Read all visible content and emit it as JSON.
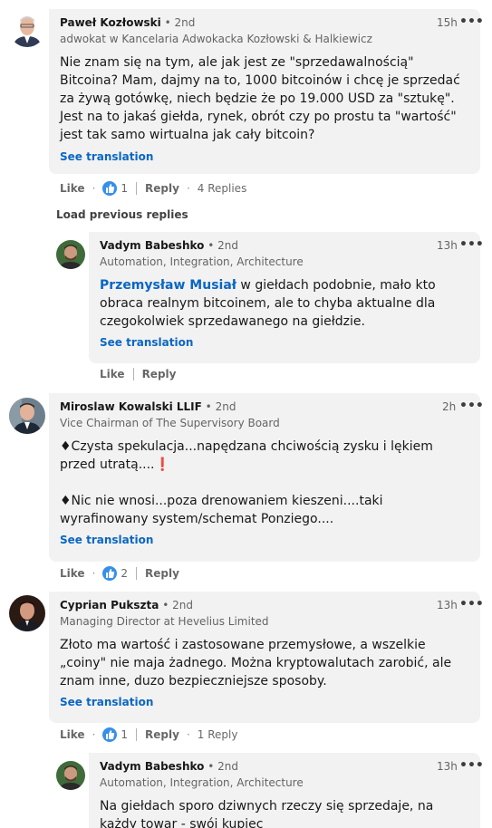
{
  "comments": [
    {
      "name": "Paweł Kozłowski",
      "degree": "2nd",
      "headline": "adwokat w Kancelaria Adwokacka Kozłowski & Halkiewicz",
      "time": "15h",
      "text": "Nie znam się na tym, ale jak jest ze \"sprzedawalnością\" Bitcoina? Mam, dajmy na to, 1000 bitcoinów i chcę je sprzedać za żywą gotówkę, niech będzie że po 19.000 USD za \"sztukę\". Jest na to jakaś giełda, rynek, obrót czy po prostu ta \"wartość\" jest tak samo wirtualna jak cały bitcoin?",
      "see_translation": "See translation",
      "like": "Like",
      "reactions": "1",
      "reply": "Reply",
      "replies_count": "4 Replies"
    },
    {
      "name": "Vadym Babeshko",
      "degree": "2nd",
      "headline": "Automation, Integration, Architecture",
      "time": "13h",
      "mention": "Przemysław Musiał",
      "text": " w giełdach podobnie, mało kto obraca realnym bitcoinem, ale to chyba aktualne dla czegokolwiek sprzedawanego na giełdzie.",
      "see_translation": "See translation",
      "like": "Like",
      "reply": "Reply"
    },
    {
      "name": "Miroslaw Kowalski LLIF",
      "degree": "2nd",
      "headline": "Vice Chairman of The Supervisory Board",
      "time": "2h",
      "text_line1": "♦Czysta spekulacja...napędzana chciwością zysku i lękiem przed utratą....",
      "exclamation": "❗",
      "text_line2": "♦Nic nie wnosi...poza drenowaniem kieszeni....taki wyrafinowany system/schemat Ponziego....",
      "see_translation": "See translation",
      "like": "Like",
      "reactions": "2",
      "reply": "Reply"
    },
    {
      "name": "Cyprian Pukszta",
      "degree": "2nd",
      "headline": "Managing Director at Hevelius Limited",
      "time": "13h",
      "text": "Złoto ma wartość i zastosowane przemysłowe, a wszelkie „coiny\" nie maja żadnego. Można kryptowalutach zarobić, ale znam inne, duzo bezpieczniejsze sposoby.",
      "see_translation": "See translation",
      "like": "Like",
      "reactions": "1",
      "reply": "Reply",
      "replies_count": "1 Reply"
    },
    {
      "name": "Vadym Babeshko",
      "degree": "2nd",
      "headline": "Automation, Integration, Architecture",
      "time": "13h",
      "text": "Na giełdach sporo dziwnych rzeczy się sprzedaje, na każdy towar - swój kupiec"
    }
  ],
  "load_previous": "Load previous replies",
  "more_icon": "•••",
  "degree_prefix": "• ",
  "dot_separator": "·",
  "colors": {
    "bubble": "#f2f2f2",
    "link": "#0a66c2",
    "like_icon": "#378fe9"
  }
}
